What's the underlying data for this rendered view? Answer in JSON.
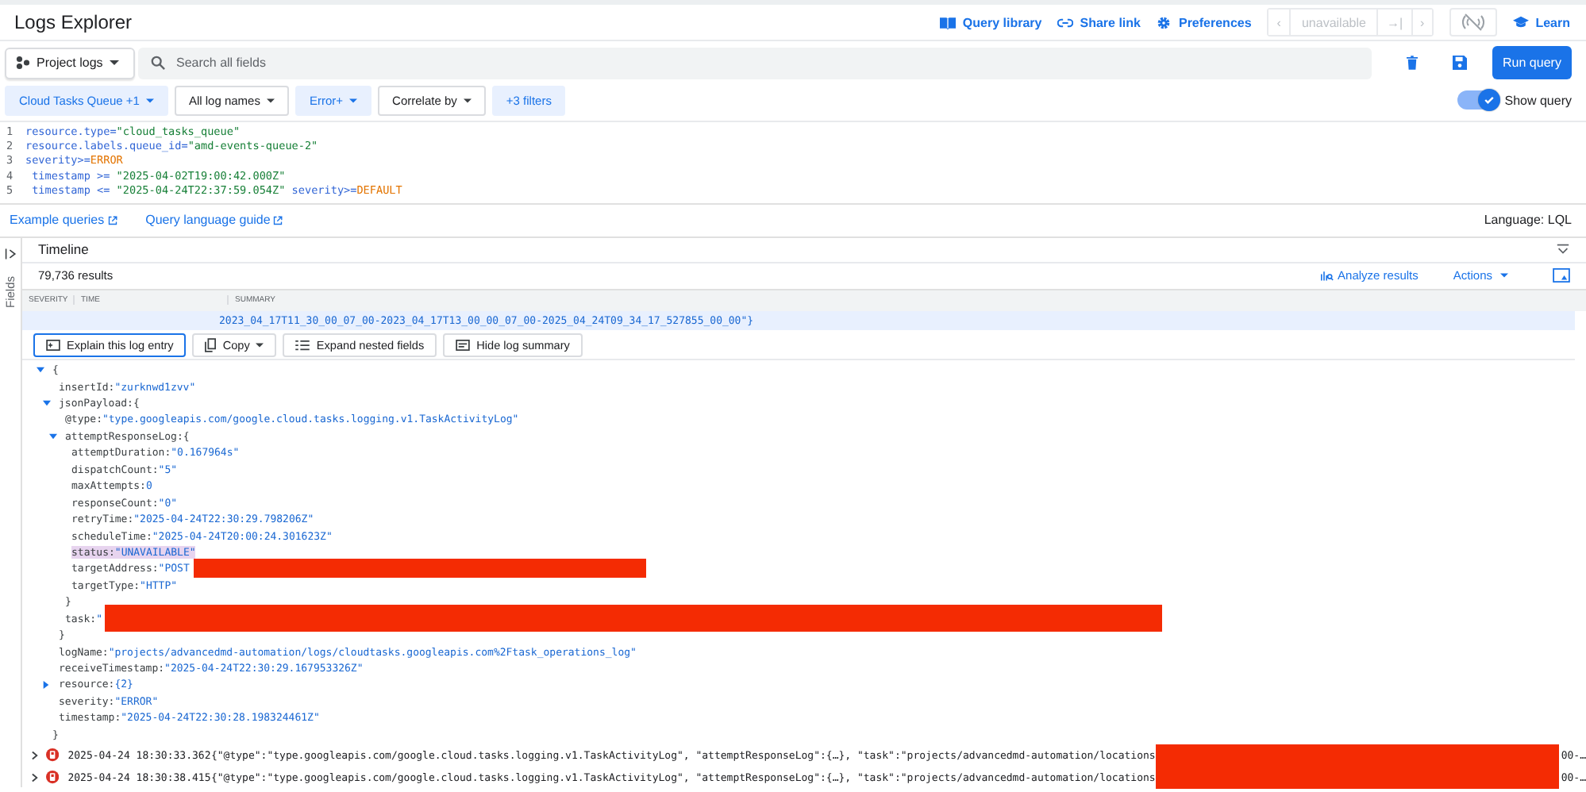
{
  "header": {
    "title": "Logs Explorer",
    "actions": [
      "Query library",
      "Share link",
      "Preferences"
    ],
    "nav": {
      "prev": "‹",
      "value": "unavailable",
      "jump": "→|",
      "next": "›",
      "disabled": true
    },
    "learn": "Learn"
  },
  "search": {
    "scope": "Project logs",
    "placeholder": "Search all fields",
    "run": "Run query"
  },
  "filters": [
    {
      "label": "Cloud Tasks Queue +1",
      "active": true,
      "caret": true
    },
    {
      "label": "All log names",
      "active": false,
      "caret": true
    },
    {
      "label": "Error+",
      "active": true,
      "caret": true
    },
    {
      "label": "Correlate by",
      "active": false,
      "caret": true
    },
    {
      "label": "+3 filters",
      "active": true,
      "caret": false
    }
  ],
  "show_query": {
    "label": "Show query",
    "on": true
  },
  "query": [
    {
      "num": "1",
      "tokens": [
        {
          "t": "resource.type=",
          "kind": "field"
        },
        {
          "t": "\"cloud_tasks_queue\"",
          "kind": "string"
        }
      ]
    },
    {
      "num": "2",
      "tokens": [
        {
          "t": "resource.labels.queue_id=",
          "kind": "field"
        },
        {
          "t": "\"amd-events-queue-2\"",
          "kind": "string"
        }
      ]
    },
    {
      "num": "3",
      "tokens": [
        {
          "t": "severity>=",
          "kind": "field"
        },
        {
          "t": "ERROR",
          "kind": "keyword"
        }
      ]
    },
    {
      "num": "4",
      "tokens": [
        {
          "t": " timestamp >= ",
          "kind": "field"
        },
        {
          "t": "\"2025-04-02T19:00:42.000Z\"",
          "kind": "string"
        }
      ]
    },
    {
      "num": "5",
      "tokens": [
        {
          "t": " timestamp <= ",
          "kind": "field"
        },
        {
          "t": "\"2025-04-24T22:37:59.054Z\"",
          "kind": "string"
        },
        {
          "t": " severity>=",
          "kind": "field"
        },
        {
          "t": "DEFAULT",
          "kind": "keyword"
        }
      ]
    }
  ],
  "links": [
    "Example queries",
    "Query language guide"
  ],
  "language": "Language: LQL",
  "fields_panel": {
    "label": "Fields"
  },
  "timeline": {
    "title": "Timeline"
  },
  "results": {
    "count": "79,736 results",
    "analyze": "Analyze results",
    "actions": "Actions"
  },
  "table": {
    "columns": [
      "SEVERITY",
      "TIME",
      "SUMMARY"
    ],
    "entry": {
      "summary_tail": "2023_04_17T11_30_00_07_00-2023_04_17T13_00_00_07_00-2025_04_24T09_34_17_527855_00_00\"}",
      "buttons": [
        {
          "label": "Explain this log entry",
          "selected": true,
          "caret": false
        },
        {
          "label": "Copy",
          "selected": false,
          "caret": true
        },
        {
          "label": "Expand nested fields",
          "selected": false,
          "caret": false
        },
        {
          "label": "Hide log summary",
          "selected": false,
          "caret": false
        }
      ],
      "tree": {
        "open": "{",
        "expanded": true,
        "close": "}",
        "children": [
          {
            "key": "insertId:",
            "value": "\"zurknwd1zvv\""
          },
          {
            "key": "jsonPayload:",
            "open": "{",
            "expanded": true,
            "close": "}",
            "children": [
              {
                "key": "@type:",
                "value": "\"type.googleapis.com/google.cloud.tasks.logging.v1.TaskActivityLog\""
              },
              {
                "key": "attemptResponseLog:",
                "open": "{",
                "expanded": true,
                "close": "}",
                "children": [
                  {
                    "key": "attemptDuration:",
                    "value": "\"0.167964s\""
                  },
                  {
                    "key": "dispatchCount:",
                    "value": "\"5\""
                  },
                  {
                    "key": "maxAttempts:",
                    "value": "0"
                  },
                  {
                    "key": "responseCount:",
                    "value": "\"0\""
                  },
                  {
                    "key": "retryTime:",
                    "value": "\"2025-04-24T22:30:29.798206Z\""
                  },
                  {
                    "key": "scheduleTime:",
                    "value": "\"2025-04-24T20:00:24.301623Z\""
                  },
                  {
                    "key": "status:",
                    "value": "\"UNAVAILABLE\"",
                    "highlighted": true
                  },
                  {
                    "key": "targetAddress:",
                    "value": "\"POST",
                    "redacted": true
                  },
                  {
                    "key": "targetType:",
                    "value": "\"HTTP\""
                  }
                ]
              },
              {
                "key": "task:",
                "value": "\"",
                "redacted": true
              }
            ]
          },
          {
            "key": "logName:",
            "value": "\"projects/advancedmd-automation/logs/cloudtasks.googleapis.com%2Ftask_operations_log\""
          },
          {
            "key": "receiveTimestamp:",
            "value": "\"2025-04-24T22:30:29.167953326Z\""
          },
          {
            "key": "resource:",
            "value": "{2}",
            "expanded": false
          },
          {
            "key": "severity:",
            "value": "\"ERROR\""
          },
          {
            "key": "timestamp:",
            "value": "\"2025-04-24T22:30:28.198324461Z\""
          }
        ]
      }
    },
    "rows": [
      {
        "expanded": false,
        "color": "#d93025",
        "time": "2025-04-24 18:30:33.362",
        "summary": "{\"@type\":\"type.googleapis.com/google.cloud.tasks.logging.v1.TaskActivityLog\", \"attemptResponseLog\":{…}, \"task\":\"projects/advancedmd-automation/locations",
        "redacted": true,
        "tail": "00-…"
      },
      {
        "expanded": false,
        "color": "#d93025",
        "time": "2025-04-24 18:30:38.415",
        "summary": "{\"@type\":\"type.googleapis.com/google.cloud.tasks.logging.v1.TaskActivityLog\", \"attemptResponseLog\":{…}, \"task\":\"projects/advancedmd-automation/locations",
        "redacted": true,
        "tail": "00-…"
      }
    ]
  }
}
